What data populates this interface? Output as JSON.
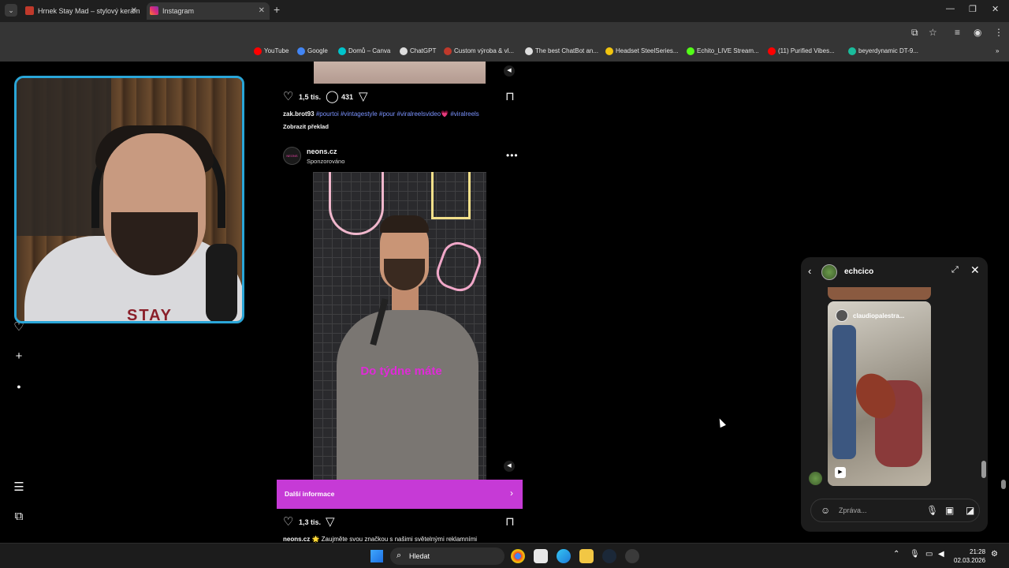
{
  "browser": {
    "tabs": [
      {
        "title": "Hrnek Stay Mad – stylový keram"
      },
      {
        "title": "Instagram"
      }
    ],
    "bookmarks": [
      {
        "label": "YouTube",
        "color": "#ff0000"
      },
      {
        "label": "Google",
        "color": "#4285f4"
      },
      {
        "label": "Domů – Canva",
        "color": "#00c4cc"
      },
      {
        "label": "ChatGPT",
        "color": "#dddddd"
      },
      {
        "label": "Custom výroba & vl...",
        "color": "#c0392b"
      },
      {
        "label": "The best ChatBot an...",
        "color": "#dddddd"
      },
      {
        "label": "Headset SteelSeries...",
        "color": "#f1c40f"
      },
      {
        "label": "Echito_LIVE Stream...",
        "color": "#53fc18"
      },
      {
        "label": "(11) Purified Vibes...",
        "color": "#ff0000"
      },
      {
        "label": "beyerdynamic DT-9...",
        "color": "#1abc9c"
      }
    ]
  },
  "feed": {
    "post1": {
      "likes": "1,5 tis.",
      "comments": "431",
      "author": "zak.brot93",
      "tags": "#pourtoi #vintagestyle #pour #viralreelsvideo",
      "tag_last": "#viralreels",
      "heart_emoji": "💗",
      "translate": "Zobrazit překlad"
    },
    "post2": {
      "account": "neons.cz",
      "sponsored": "Sponzorováno",
      "overlay": "Do týdne máte",
      "cta": "Další informace",
      "likes": "1,3 tis.",
      "caption_author": "neons.cz",
      "caption_text": "🌟 Zaujměte svou značkou s našimi světelnými reklamními"
    }
  },
  "webcam": {
    "shirt_text": "STAY"
  },
  "chat": {
    "username": "echcico",
    "reel_user": "claudiopalestra...",
    "message_placeholder": "Zpráva..."
  },
  "taskbar": {
    "search_label": "Hledat",
    "time": "21:28",
    "date": "02.03.2026"
  }
}
